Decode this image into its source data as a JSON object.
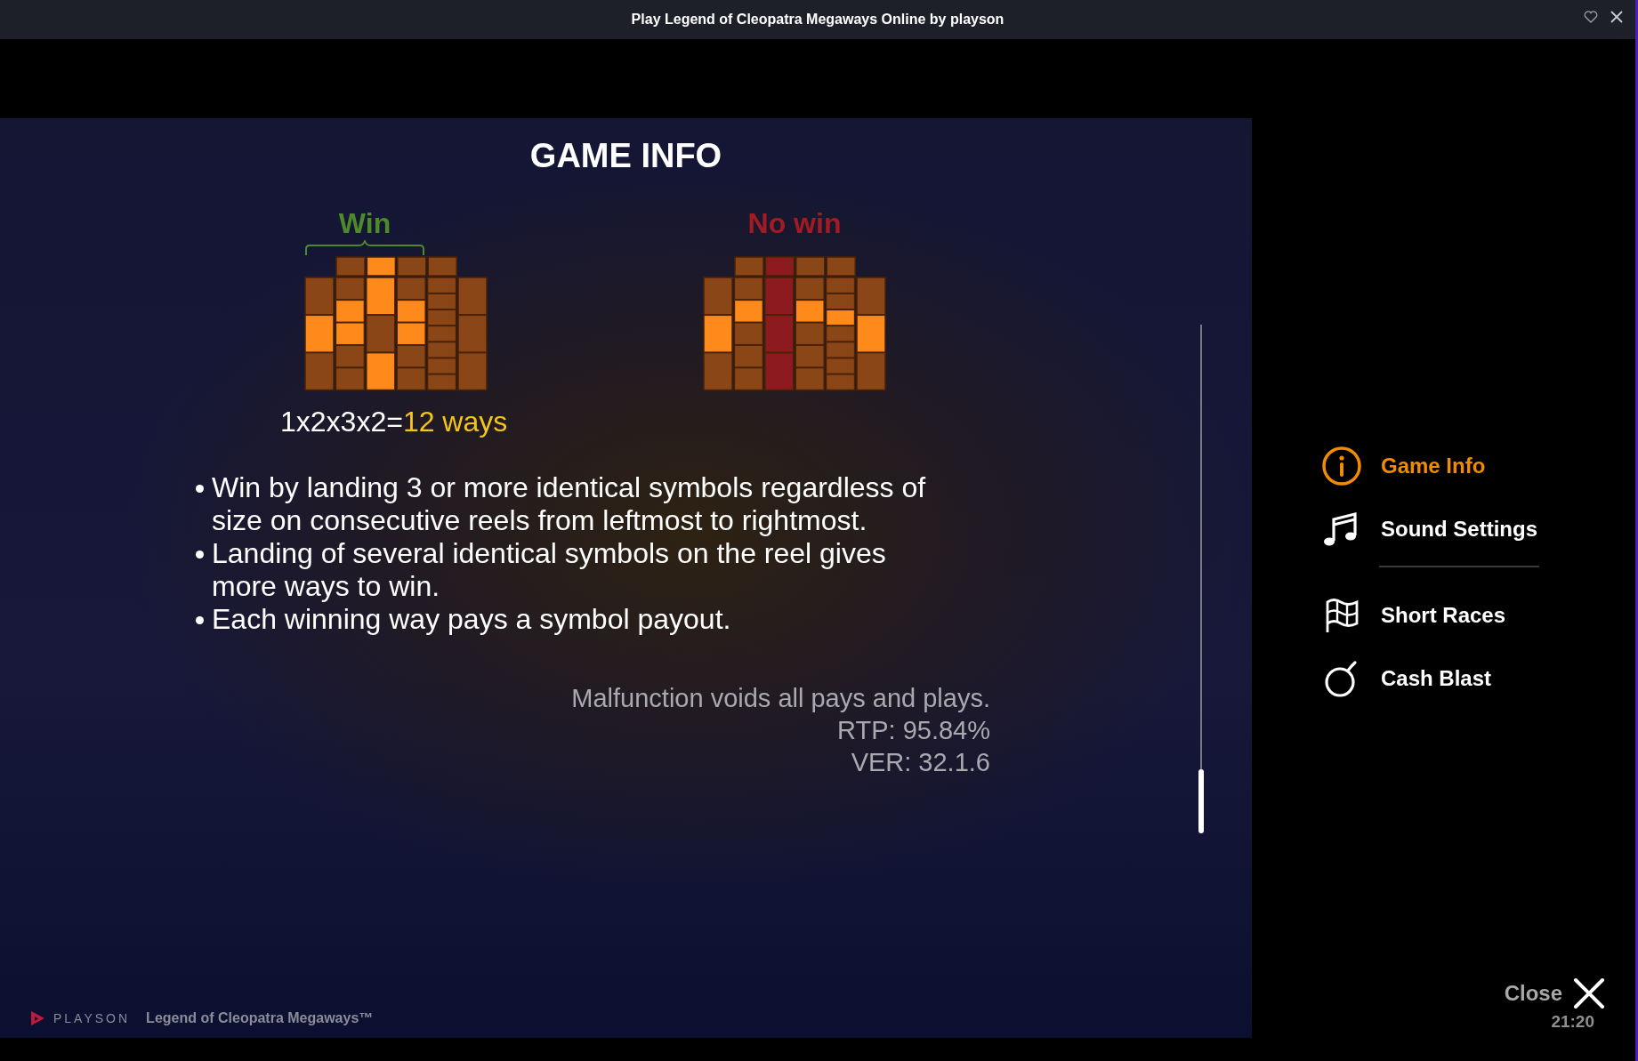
{
  "window": {
    "title": "Play Legend of Cleopatra Megaways Online by playson"
  },
  "panel": {
    "title": "GAME INFO",
    "examples": [
      {
        "kind": "win",
        "label": "Win"
      },
      {
        "kind": "no_win",
        "label": "No win"
      }
    ],
    "formula": {
      "expression": "1x2x3x2=",
      "result": "12 ways"
    },
    "bullets": [
      "Win by landing 3 or more identical symbols regardless of size on consecutive reels from leftmost to rightmost.",
      "Landing of several identical symbols on the reel gives more ways to win.",
      "Each winning way pays a symbol payout."
    ],
    "notes": [
      "Malfunction voids all pays and plays.",
      "RTP: 95.84%",
      "VER: 32.1.6"
    ]
  },
  "footer": {
    "brand": "PLAYSON",
    "game": "Legend of Cleopatra Megaways™"
  },
  "menu": [
    {
      "kind": "info",
      "label": "Game Info",
      "selected": true
    },
    {
      "kind": "music",
      "label": "Sound Settings",
      "selected": false
    },
    {
      "kind": "divider"
    },
    {
      "kind": "flag",
      "label": "Short Races",
      "selected": false
    },
    {
      "kind": "bomb",
      "label": "Cash Blast",
      "selected": false
    }
  ],
  "close": {
    "label": "Close",
    "time": "21:20"
  }
}
